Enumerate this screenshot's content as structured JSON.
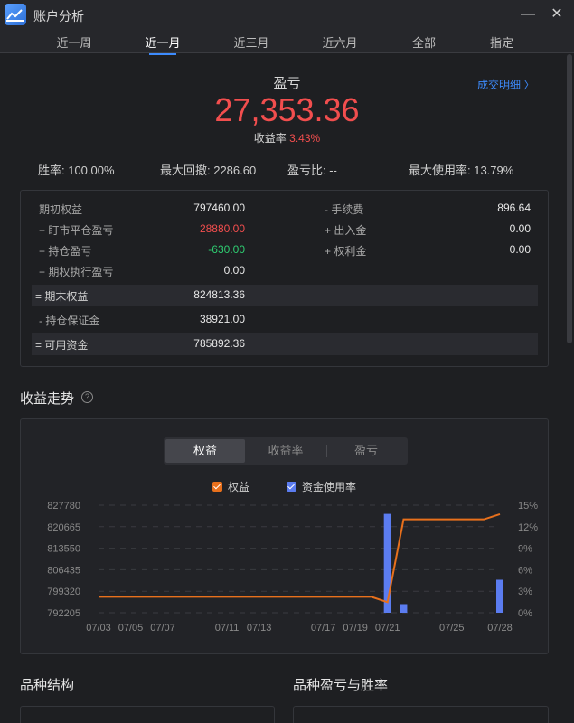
{
  "window": {
    "title": "账户分析",
    "min_label": "—",
    "close_label": "✕"
  },
  "tabs": [
    "近一周",
    "近一月",
    "近三月",
    "近六月",
    "全部",
    "指定"
  ],
  "summary": {
    "pnl_label": "盈亏",
    "pnl_value": "27,353.36",
    "rate_label": "收益率",
    "rate_value": "3.43%",
    "detail_link": "成交明细 〉"
  },
  "stats": {
    "win_rate": "胜率: 100.00%",
    "max_drawdown": "最大回撤: 2286.60",
    "pl_ratio": "盈亏比: --",
    "max_usage": "最大使用率: 13.79%"
  },
  "breakdown": {
    "left": [
      {
        "label": "期初权益",
        "value": "797460.00",
        "tone": "normal"
      },
      {
        "label": "+ 盯市平仓盈亏",
        "value": "28880.00",
        "tone": "red"
      },
      {
        "label": "+ 持仓盈亏",
        "value": "-630.00",
        "tone": "green"
      },
      {
        "label": "+ 期权执行盈亏",
        "value": "0.00",
        "tone": "normal"
      },
      {
        "label": "= 期末权益",
        "value": "824813.36",
        "tone": "normal"
      },
      {
        "label": "- 持仓保证金",
        "value": "38921.00",
        "tone": "normal"
      },
      {
        "label": "= 可用资金",
        "value": "785892.36",
        "tone": "normal"
      }
    ],
    "right": [
      {
        "label": "- 手续费",
        "value": "896.64"
      },
      {
        "label": "+ 出入金",
        "value": "0.00"
      },
      {
        "label": "+ 权利金",
        "value": "0.00"
      }
    ]
  },
  "trend": {
    "title": "收益走势",
    "help_icon": "?",
    "segments": [
      "权益",
      "收益率",
      "盈亏"
    ],
    "legend": [
      {
        "name": "权益",
        "color": "#e8701c"
      },
      {
        "name": "资金使用率",
        "color": "#5b7cf0"
      }
    ]
  },
  "chart_data": {
    "type": "line",
    "x_labels": [
      "07/03",
      "07/05",
      "07/07",
      "07/11",
      "07/13",
      "07/17",
      "07/19",
      "07/21",
      "07/25",
      "07/28"
    ],
    "y_left_ticks": [
      "827780",
      "820665",
      "813550",
      "806435",
      "799320",
      "792205"
    ],
    "y_right_ticks": [
      "15%",
      "12%",
      "9%",
      "6%",
      "3%",
      "0%"
    ],
    "ylim_left": [
      792205,
      827780
    ],
    "ylim_right": [
      0,
      15
    ],
    "series": [
      {
        "name": "权益",
        "kind": "line",
        "x": [
          "07/03",
          "07/05",
          "07/07",
          "07/11",
          "07/13",
          "07/17",
          "07/19",
          "07/20",
          "07/21",
          "07/22",
          "07/25",
          "07/27",
          "07/28"
        ],
        "values": [
          797460,
          797460,
          797460,
          797460,
          797460,
          797460,
          797460,
          797460,
          795700,
          823100,
          823100,
          823100,
          824813
        ]
      },
      {
        "name": "资金使用率",
        "kind": "bar",
        "x": [
          "07/21",
          "07/22",
          "07/28"
        ],
        "values": [
          13.79,
          1.2,
          4.6
        ]
      }
    ]
  },
  "bottom": {
    "left_title": "品种结构",
    "right_title": "品种盈亏与胜率"
  }
}
